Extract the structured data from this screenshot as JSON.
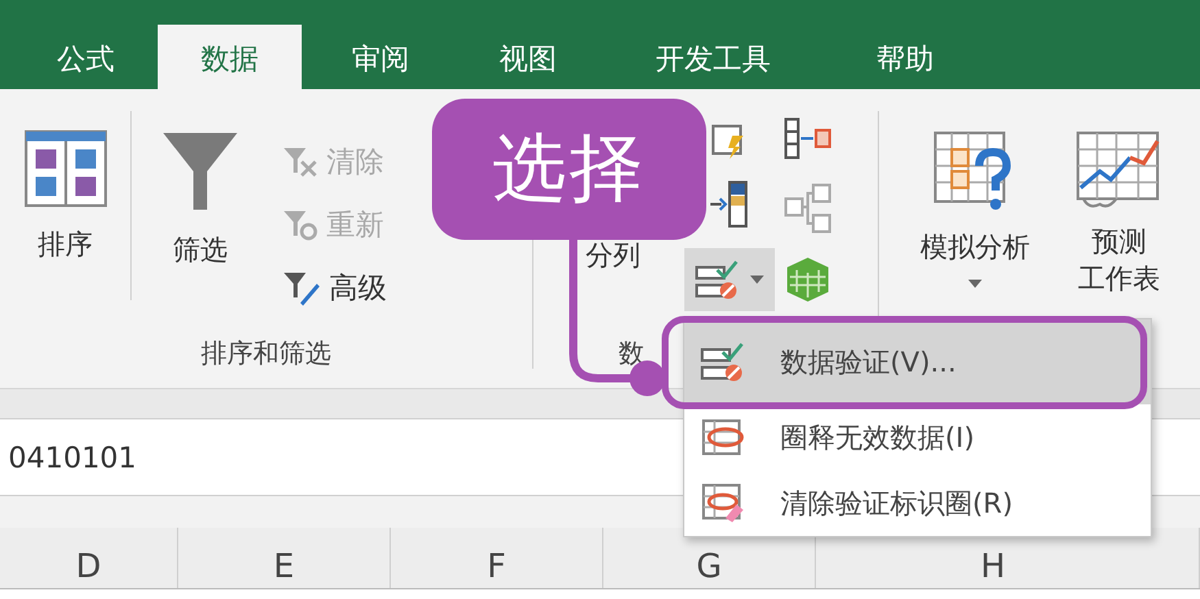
{
  "tabs": [
    {
      "label": "公式",
      "selected": false
    },
    {
      "label": "数据",
      "selected": true
    },
    {
      "label": "审阅",
      "selected": false
    },
    {
      "label": "视图",
      "selected": false
    },
    {
      "label": "开发工具",
      "selected": false
    },
    {
      "label": "帮助",
      "selected": false
    }
  ],
  "ribbon": {
    "sort_filter_group": {
      "sort_button": "排序",
      "filter_button": "筛选",
      "small_buttons": [
        {
          "label": "清除",
          "disabled": true
        },
        {
          "label": "重新",
          "disabled": true
        },
        {
          "label": "高级",
          "disabled": false
        }
      ],
      "label": "排序和筛选"
    },
    "data_tools_group": {
      "text_to_columns_button": "分列",
      "label": "数"
    },
    "forecast_group": {
      "what_if_button": "模拟分析",
      "forecast_sheet_button": [
        "预测",
        "工作表"
      ]
    }
  },
  "formula_bar": {
    "value": "0410101"
  },
  "column_headers": [
    "D",
    "E",
    "F",
    "G",
    "H"
  ],
  "dropdown_menu": [
    {
      "label": "数据验证(V)...",
      "selected": true
    },
    {
      "label": "圈释无效数据(I)",
      "selected": false
    },
    {
      "label": "清除验证标识圈(R)",
      "selected": false
    }
  ],
  "callout": {
    "text": "选择"
  }
}
